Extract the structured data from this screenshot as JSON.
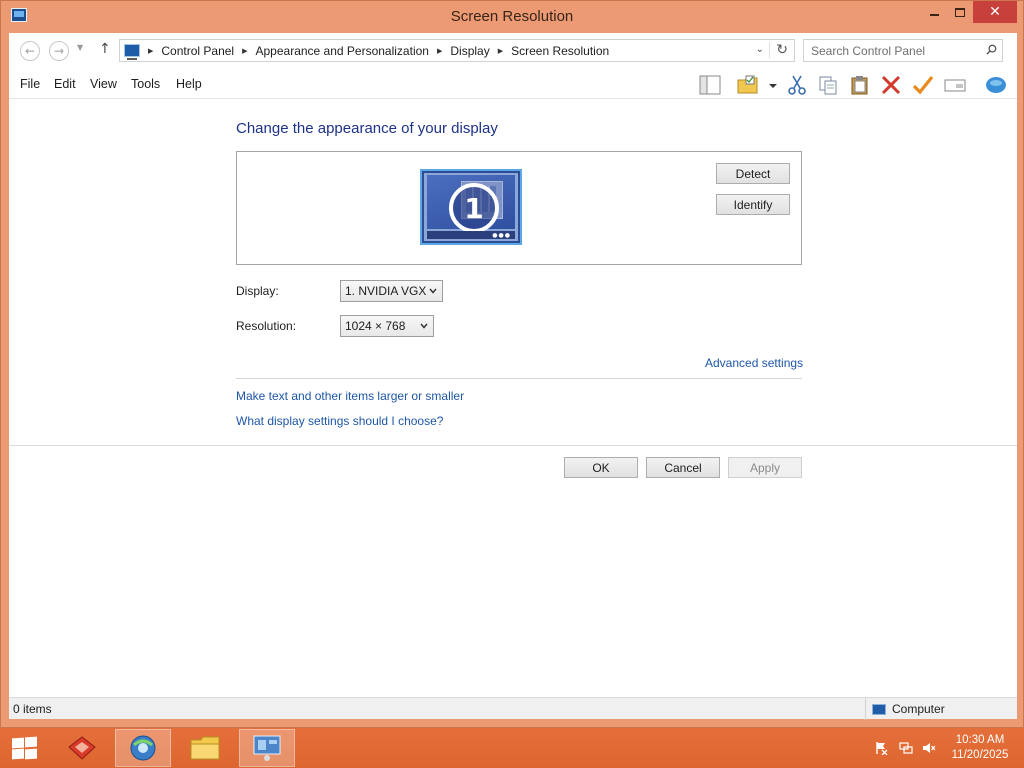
{
  "window": {
    "title": "Screen Resolution"
  },
  "address": {
    "breadcrumbs": [
      "Control Panel",
      "Appearance and Personalization",
      "Display",
      "Screen Resolution"
    ]
  },
  "search": {
    "placeholder": "Search Control Panel"
  },
  "menu": {
    "file": "File",
    "edit": "Edit",
    "view": "View",
    "tools": "Tools",
    "help": "Help"
  },
  "toolbar": {
    "icons": [
      "layout-icon",
      "folder-options-icon",
      "cut-icon",
      "copy-icon",
      "paste-icon",
      "delete-icon",
      "properties-check-icon",
      "rename-icon",
      "feedback-icon"
    ]
  },
  "content": {
    "heading": "Change the appearance of your display",
    "monitor_number": "1",
    "detect_label": "Detect",
    "identify_label": "Identify",
    "display_label": "Display:",
    "display_value": "1. NVIDIA VGX",
    "resolution_label": "Resolution:",
    "resolution_value": "1024 × 768",
    "advanced_link": "Advanced settings",
    "text_size_link": "Make text and other items larger or smaller",
    "what_settings_link": "What display settings should I choose?",
    "ok_label": "OK",
    "cancel_label": "Cancel",
    "apply_label": "Apply"
  },
  "status": {
    "items": "0 items",
    "location": "Computer"
  },
  "taskbar": {
    "time": "10:30 AM",
    "date": "11/20/2025",
    "accent": "#e06a34"
  },
  "colors": {
    "link": "#1e57a8",
    "heading": "#1e3287",
    "close_button": "#c7403c",
    "frame": "#eb9a73"
  }
}
